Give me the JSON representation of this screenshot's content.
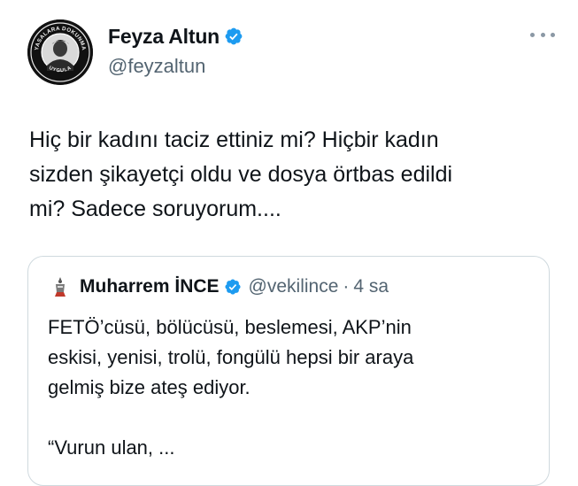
{
  "author": {
    "display_name": "Feyza Altun",
    "handle": "@feyzaltun",
    "verified_icon": "verified-badge-icon",
    "avatar_ring_text_top": "YASALARA DOKUNMA",
    "avatar_ring_text_bottom": "UYGULA",
    "avatar_icon": "profile-photo"
  },
  "more_options_icon": "more-horizontal-icon",
  "tweet": {
    "text": "Hiç bir kadını taciz ettiniz mi? Hiçbir kadın\nsizden şikayetçi oldu ve dosya örtbas edildi\nmi? Sadece soruyorum...."
  },
  "quote": {
    "display_name": "Muharrem İNCE",
    "handle": "@vekilince",
    "separator": "·",
    "time": "4 sa",
    "avatar_icon": "party-emblem-avatar",
    "text": "FETÖ’cüsü, bölücüsü, beslemesi, AKP’nin\neskisi, yenisi, trolü, fongülü hepsi bir araya\ngelmiş bize ateş ediyor.\n\n“Vurun ulan, ..."
  },
  "colors": {
    "text_primary": "#0f1419",
    "text_secondary": "#536471",
    "verified_blue": "#1d9bf0",
    "border": "#cfd9de"
  }
}
